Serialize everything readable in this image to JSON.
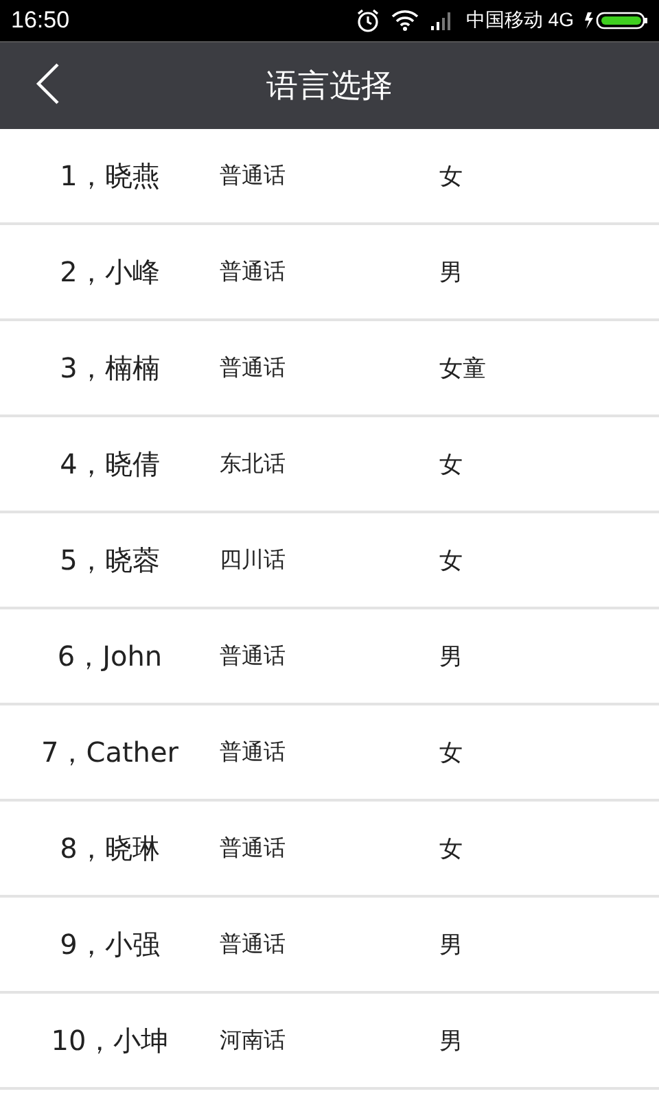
{
  "status_bar": {
    "time": "16:50",
    "carrier": "中国移动 4G"
  },
  "header": {
    "title": "语言选择"
  },
  "voices": [
    {
      "name": "1，晓燕",
      "dialect": "普通话",
      "gender": "女"
    },
    {
      "name": "2，小峰",
      "dialect": "普通话",
      "gender": "男"
    },
    {
      "name": "3，楠楠",
      "dialect": "普通话",
      "gender": "女童"
    },
    {
      "name": "4，晓倩",
      "dialect": "东北话",
      "gender": "女"
    },
    {
      "name": "5，晓蓉",
      "dialect": "四川话",
      "gender": "女"
    },
    {
      "name": "6，John",
      "dialect": "普通话",
      "gender": "男"
    },
    {
      "name": "7，Cather",
      "dialect": "普通话",
      "gender": "女"
    },
    {
      "name": "8，晓琳",
      "dialect": "普通话",
      "gender": "女"
    },
    {
      "name": "9，小强",
      "dialect": "普通话",
      "gender": "男"
    },
    {
      "name": "10，小坤",
      "dialect": "河南话",
      "gender": "男"
    }
  ]
}
